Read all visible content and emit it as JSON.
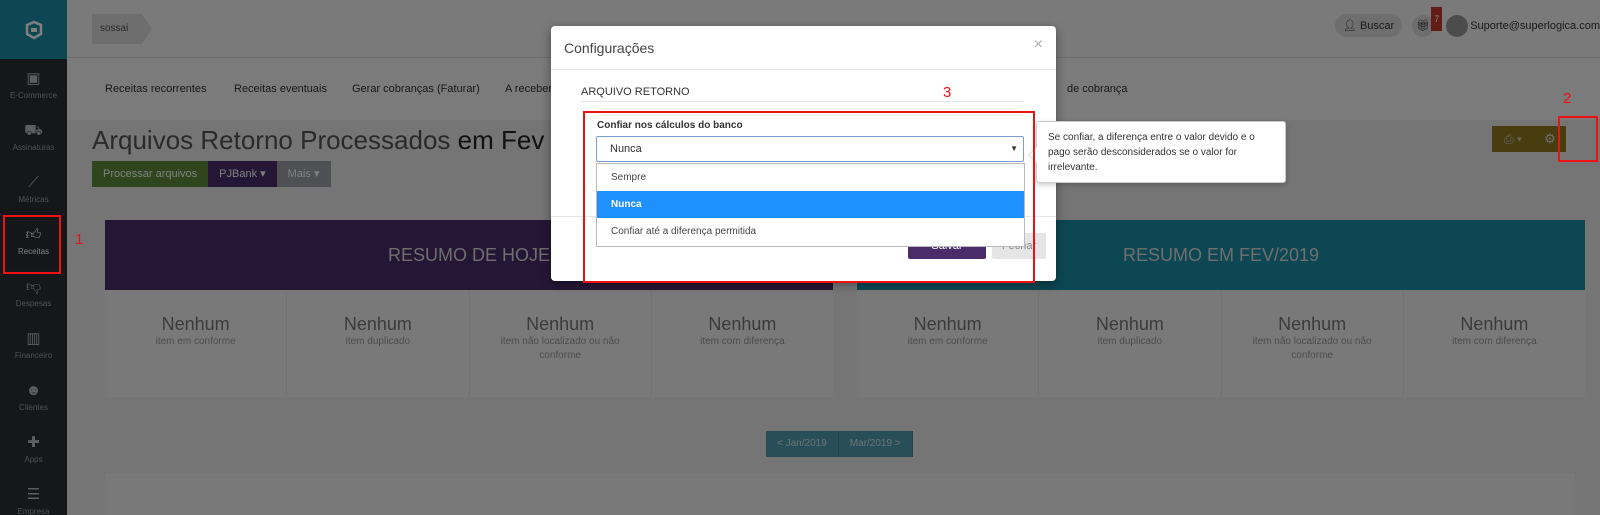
{
  "sidebar": {
    "items": [
      {
        "label": "E-Commerce",
        "icon": "shopping-bag-icon"
      },
      {
        "label": "Assinaturas",
        "icon": "cart-icon"
      },
      {
        "label": "Métricas",
        "icon": "chart-line-icon"
      },
      {
        "label": "Receitas",
        "icon": "thumbs-up-icon"
      },
      {
        "label": "Despesas",
        "icon": "thumbs-down-icon"
      },
      {
        "label": "Financeiro",
        "icon": "bar-chart-icon"
      },
      {
        "label": "Clientes",
        "icon": "users-icon"
      },
      {
        "label": "Apps",
        "icon": "puzzle-icon"
      },
      {
        "label": "Empresa",
        "icon": "menu-icon"
      }
    ]
  },
  "topbar": {
    "breadcrumb": "sossai",
    "search_label": "Buscar",
    "gift_badge": "7",
    "user": "Suporte@superlogica.com"
  },
  "subnav": {
    "items": [
      "Receitas recorrentes",
      "Receitas eventuais",
      "Gerar cobranças (Faturar)",
      "A receber",
      "de cobrança"
    ]
  },
  "page": {
    "title_part1": "Arquivos Retorno Processados",
    "title_part2": "em Fev",
    "buttons": {
      "process": "Processar arquivos",
      "bank": "PJBank",
      "more": "Mais"
    }
  },
  "cards": {
    "today_title": "RESUMO DE HOJE",
    "month_title": "RESUMO EM FEV/2019",
    "cells": [
      {
        "value": "Nenhum",
        "label": "item em conforme"
      },
      {
        "value": "Nenhum",
        "label": "item duplicado"
      },
      {
        "value": "Nenhum",
        "label": "item não localizado ou não conforme"
      },
      {
        "value": "Nenhum",
        "label": "item com diferença"
      }
    ]
  },
  "pager": {
    "prev": "< Jan/2019",
    "next": "Mar/2019 >"
  },
  "modal": {
    "title": "Configurações",
    "close": "×",
    "section": "ARQUIVO RETORNO",
    "field_label": "Confiar nos cálculos do banco",
    "selected": "Nunca",
    "options": [
      "Sempre",
      "Nunca",
      "Confiar até a diferença permitida"
    ],
    "save": "Salvar",
    "close_button": "Fechar",
    "help": "Se confiar, a diferença entre o valor devido e o pago serão desconsiderados se o valor for irrelevante."
  },
  "annotations": {
    "n1": "1",
    "n2": "2",
    "n3": "3"
  },
  "colors": {
    "accent": "#1b8fa7",
    "purple": "#4b2c6a",
    "green": "#5d8a3a",
    "highlight": "#ee1111",
    "selected": "#1e90ff"
  }
}
